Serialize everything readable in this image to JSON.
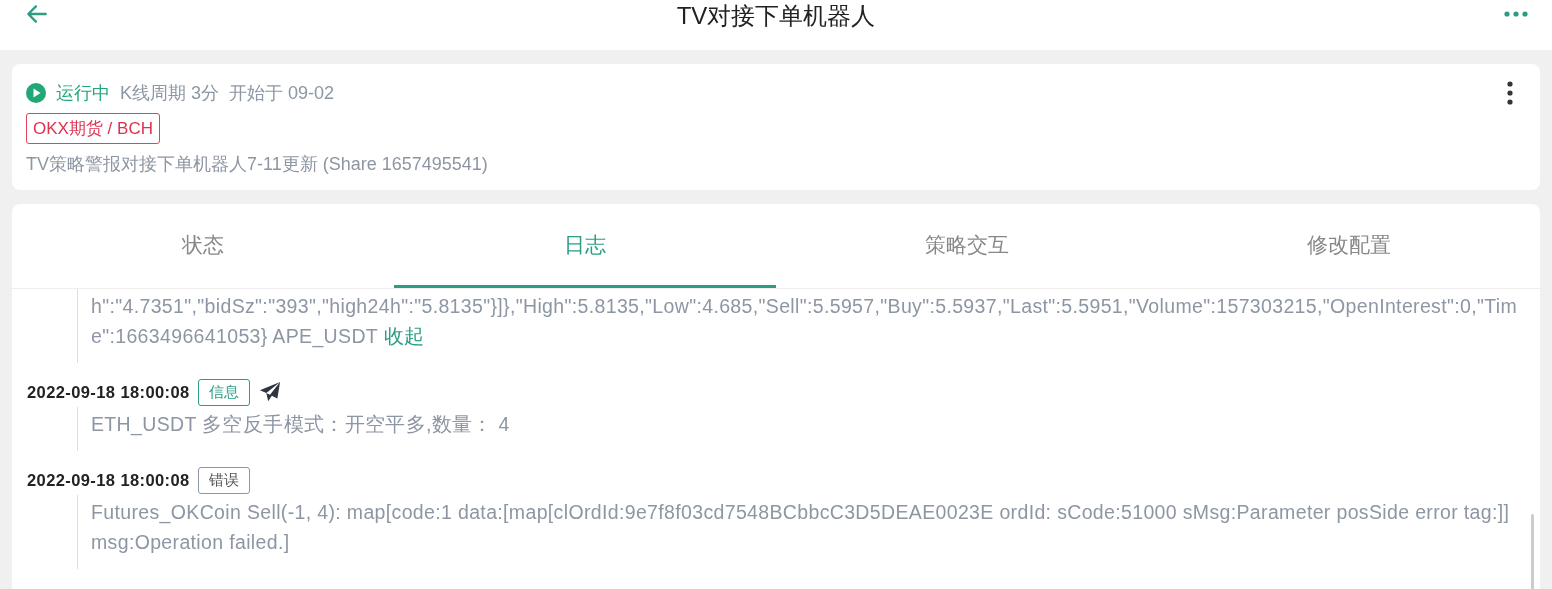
{
  "header": {
    "title": "TV对接下单机器人"
  },
  "robot": {
    "status": "运行中",
    "running": true,
    "period": "K线周期 3分",
    "started": "开始于 09-02",
    "exchange_tag": "OKX期货 / BCH",
    "strategy": "TV策略警报对接下单机器人7-11更新 (Share 1657495541)"
  },
  "tabs": [
    {
      "label": "状态",
      "selected": false
    },
    {
      "label": "日志",
      "selected": true
    },
    {
      "label": "策略交互",
      "selected": false
    },
    {
      "label": "修改配置",
      "selected": false
    }
  ],
  "logs": [
    {
      "kind": "continued",
      "text": "h\":\"4.7351\",\"bidSz\":\"393\",\"high24h\":\"5.8135\"}]},\"High\":5.8135,\"Low\":4.685,\"Sell\":5.5957,\"Buy\":5.5937,\"Last\":5.5951,\"Volume\":157303215,\"OpenInterest\":0,\"Time\":1663496641053} APE_USDT",
      "link": "收起"
    },
    {
      "kind": "entry",
      "time": "2022-09-18 18:00:08",
      "tag": {
        "kind": "info",
        "label": "信息"
      },
      "pushed": true,
      "text": "ETH_USDT 多空反手模式：开空平多,数量： 4"
    },
    {
      "kind": "entry",
      "time": "2022-09-18 18:00:08",
      "tag": {
        "kind": "error",
        "label": "错误"
      },
      "pushed": false,
      "text": "Futures_OKCoin  Sell(-1, 4): map[code:1 data:[map[clOrdId:9e7f8f03cd7548BCbbcC3D5DEAE0023E ordId: sCode:51000 sMsg:Parameter posSide error  tag:]] msg:Operation failed.]"
    }
  ]
}
